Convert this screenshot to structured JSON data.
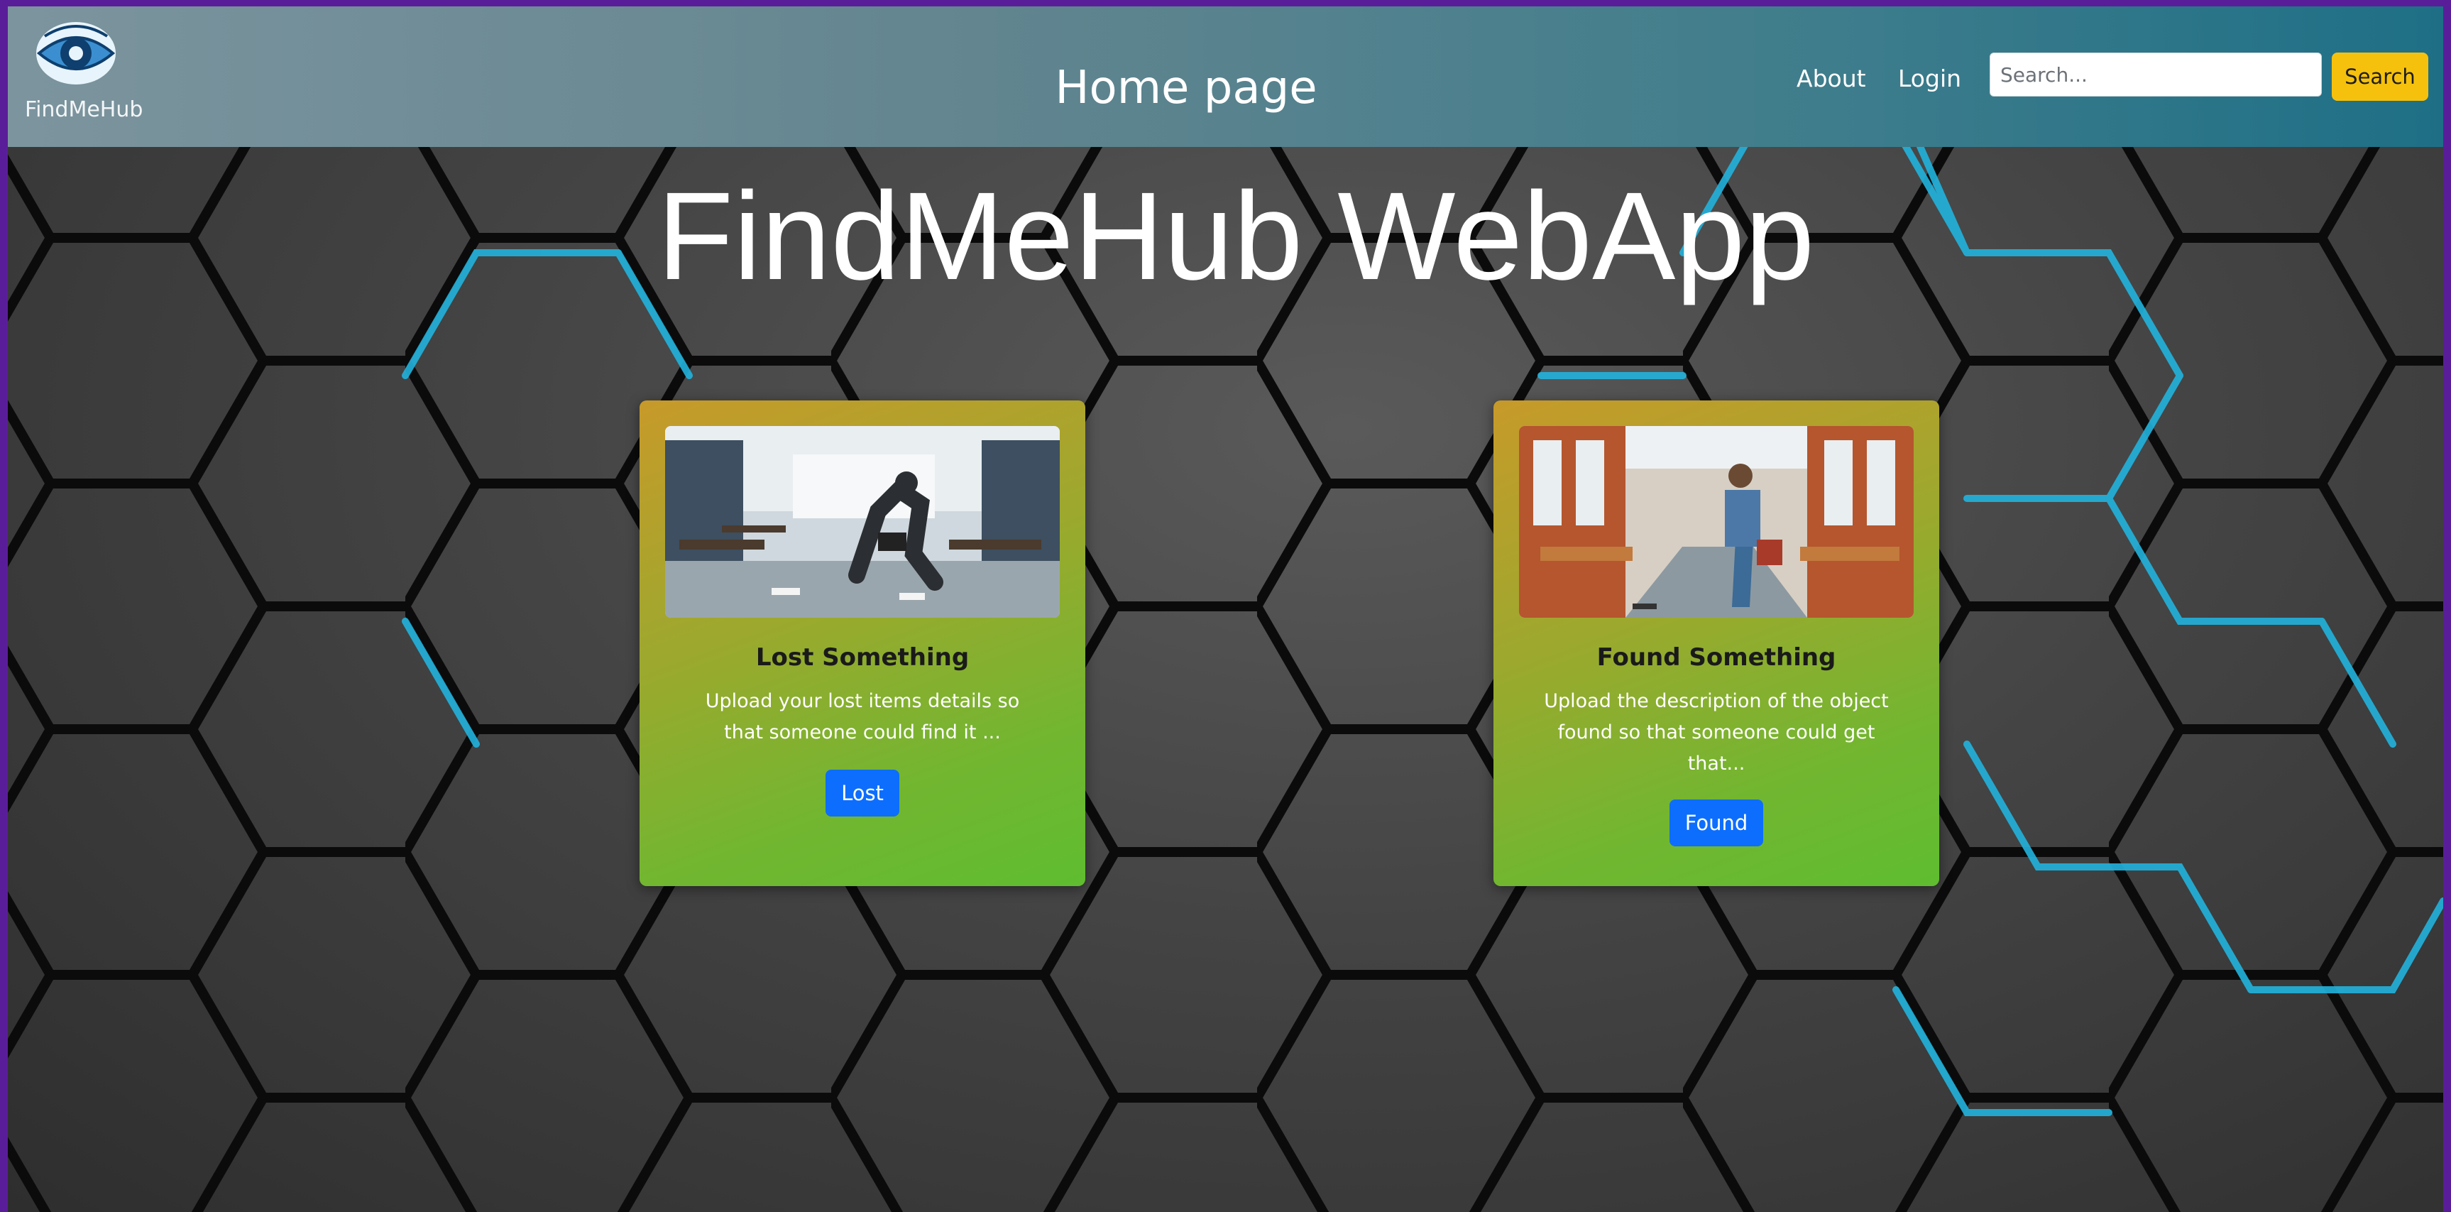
{
  "navbar": {
    "brand_name": "FindMeHub",
    "brand_icon": "eye-logo-icon",
    "page_title": "Home page",
    "links": {
      "about": "About",
      "login": "Login"
    },
    "search": {
      "placeholder": "Search...",
      "value": "",
      "button_label": "Search"
    }
  },
  "hero": {
    "title": "FindMeHub WebApp"
  },
  "cards": {
    "lost": {
      "title": "Lost Something",
      "text": "Upload your lost items details so that someone could find it ...",
      "button_label": "Lost"
    },
    "found": {
      "title": "Found Something",
      "text": "Upload the description of the object found so that someone could get that...",
      "button_label": "Found"
    }
  },
  "colors": {
    "page_border": "#5a1d9a",
    "search_button": "#f6c10d",
    "primary_button": "#0d6efd",
    "hex_glow": "#22b3dd"
  }
}
